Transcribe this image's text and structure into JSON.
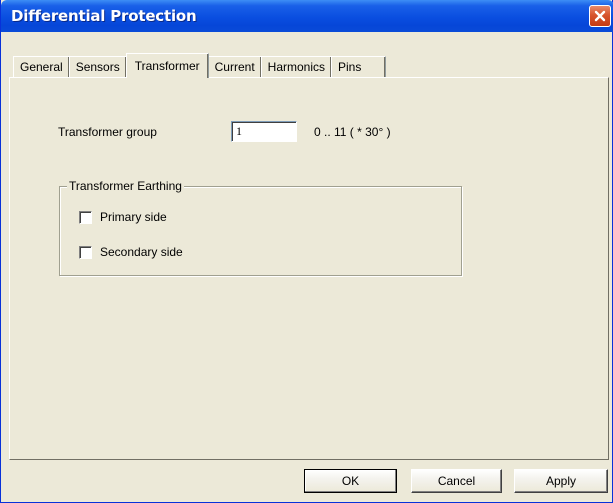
{
  "window": {
    "title": "Differential Protection"
  },
  "tabs": [
    {
      "label": "General",
      "active": false
    },
    {
      "label": "Sensors",
      "active": false
    },
    {
      "label": "Transformer",
      "active": true
    },
    {
      "label": "Current",
      "active": false
    },
    {
      "label": "Harmonics",
      "active": false
    },
    {
      "label": "Pins",
      "active": false
    }
  ],
  "transformer_group": {
    "label": "Transformer group",
    "value": "1",
    "range_hint": "0 .. 11  ( * 30° )"
  },
  "earthing": {
    "legend": "Transformer Earthing",
    "primary_label": "Primary side",
    "primary_checked": false,
    "secondary_label": "Secondary side",
    "secondary_checked": false
  },
  "buttons": {
    "ok": "OK",
    "cancel": "Cancel",
    "apply": "Apply"
  },
  "colors": {
    "titlebar": "#0a4ee0",
    "close": "#d7542d",
    "dialog_bg": "#ece9d8"
  }
}
